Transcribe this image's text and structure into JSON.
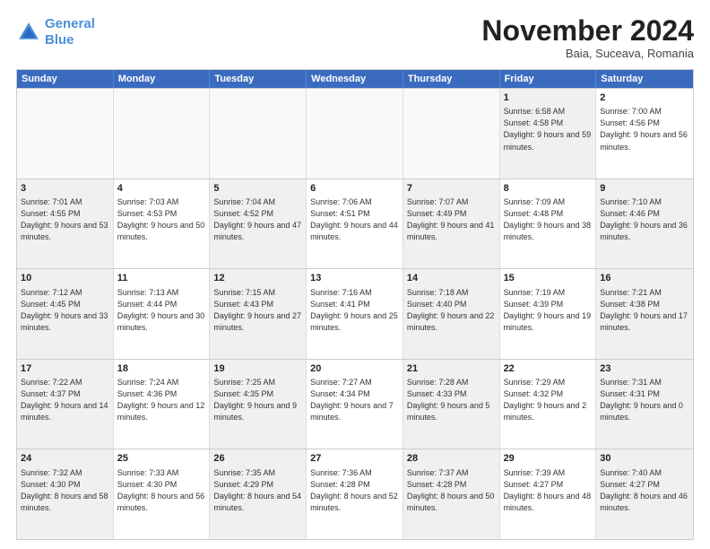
{
  "logo": {
    "line1": "General",
    "line2": "Blue"
  },
  "title": "November 2024",
  "location": "Baia, Suceava, Romania",
  "headers": [
    "Sunday",
    "Monday",
    "Tuesday",
    "Wednesday",
    "Thursday",
    "Friday",
    "Saturday"
  ],
  "weeks": [
    [
      {
        "day": "",
        "info": "",
        "empty": true
      },
      {
        "day": "",
        "info": "",
        "empty": true
      },
      {
        "day": "",
        "info": "",
        "empty": true
      },
      {
        "day": "",
        "info": "",
        "empty": true
      },
      {
        "day": "",
        "info": "",
        "empty": true
      },
      {
        "day": "1",
        "info": "Sunrise: 6:58 AM\nSunset: 4:58 PM\nDaylight: 9 hours and 59 minutes.",
        "shaded": true
      },
      {
        "day": "2",
        "info": "Sunrise: 7:00 AM\nSunset: 4:56 PM\nDaylight: 9 hours and 56 minutes.",
        "shaded": false
      }
    ],
    [
      {
        "day": "3",
        "info": "Sunrise: 7:01 AM\nSunset: 4:55 PM\nDaylight: 9 hours and 53 minutes.",
        "shaded": true
      },
      {
        "day": "4",
        "info": "Sunrise: 7:03 AM\nSunset: 4:53 PM\nDaylight: 9 hours and 50 minutes.",
        "shaded": false
      },
      {
        "day": "5",
        "info": "Sunrise: 7:04 AM\nSunset: 4:52 PM\nDaylight: 9 hours and 47 minutes.",
        "shaded": true
      },
      {
        "day": "6",
        "info": "Sunrise: 7:06 AM\nSunset: 4:51 PM\nDaylight: 9 hours and 44 minutes.",
        "shaded": false
      },
      {
        "day": "7",
        "info": "Sunrise: 7:07 AM\nSunset: 4:49 PM\nDaylight: 9 hours and 41 minutes.",
        "shaded": true
      },
      {
        "day": "8",
        "info": "Sunrise: 7:09 AM\nSunset: 4:48 PM\nDaylight: 9 hours and 38 minutes.",
        "shaded": false
      },
      {
        "day": "9",
        "info": "Sunrise: 7:10 AM\nSunset: 4:46 PM\nDaylight: 9 hours and 36 minutes.",
        "shaded": true
      }
    ],
    [
      {
        "day": "10",
        "info": "Sunrise: 7:12 AM\nSunset: 4:45 PM\nDaylight: 9 hours and 33 minutes.",
        "shaded": true
      },
      {
        "day": "11",
        "info": "Sunrise: 7:13 AM\nSunset: 4:44 PM\nDaylight: 9 hours and 30 minutes.",
        "shaded": false
      },
      {
        "day": "12",
        "info": "Sunrise: 7:15 AM\nSunset: 4:43 PM\nDaylight: 9 hours and 27 minutes.",
        "shaded": true
      },
      {
        "day": "13",
        "info": "Sunrise: 7:16 AM\nSunset: 4:41 PM\nDaylight: 9 hours and 25 minutes.",
        "shaded": false
      },
      {
        "day": "14",
        "info": "Sunrise: 7:18 AM\nSunset: 4:40 PM\nDaylight: 9 hours and 22 minutes.",
        "shaded": true
      },
      {
        "day": "15",
        "info": "Sunrise: 7:19 AM\nSunset: 4:39 PM\nDaylight: 9 hours and 19 minutes.",
        "shaded": false
      },
      {
        "day": "16",
        "info": "Sunrise: 7:21 AM\nSunset: 4:38 PM\nDaylight: 9 hours and 17 minutes.",
        "shaded": true
      }
    ],
    [
      {
        "day": "17",
        "info": "Sunrise: 7:22 AM\nSunset: 4:37 PM\nDaylight: 9 hours and 14 minutes.",
        "shaded": true
      },
      {
        "day": "18",
        "info": "Sunrise: 7:24 AM\nSunset: 4:36 PM\nDaylight: 9 hours and 12 minutes.",
        "shaded": false
      },
      {
        "day": "19",
        "info": "Sunrise: 7:25 AM\nSunset: 4:35 PM\nDaylight: 9 hours and 9 minutes.",
        "shaded": true
      },
      {
        "day": "20",
        "info": "Sunrise: 7:27 AM\nSunset: 4:34 PM\nDaylight: 9 hours and 7 minutes.",
        "shaded": false
      },
      {
        "day": "21",
        "info": "Sunrise: 7:28 AM\nSunset: 4:33 PM\nDaylight: 9 hours and 5 minutes.",
        "shaded": true
      },
      {
        "day": "22",
        "info": "Sunrise: 7:29 AM\nSunset: 4:32 PM\nDaylight: 9 hours and 2 minutes.",
        "shaded": false
      },
      {
        "day": "23",
        "info": "Sunrise: 7:31 AM\nSunset: 4:31 PM\nDaylight: 9 hours and 0 minutes.",
        "shaded": true
      }
    ],
    [
      {
        "day": "24",
        "info": "Sunrise: 7:32 AM\nSunset: 4:30 PM\nDaylight: 8 hours and 58 minutes.",
        "shaded": true
      },
      {
        "day": "25",
        "info": "Sunrise: 7:33 AM\nSunset: 4:30 PM\nDaylight: 8 hours and 56 minutes.",
        "shaded": false
      },
      {
        "day": "26",
        "info": "Sunrise: 7:35 AM\nSunset: 4:29 PM\nDaylight: 8 hours and 54 minutes.",
        "shaded": true
      },
      {
        "day": "27",
        "info": "Sunrise: 7:36 AM\nSunset: 4:28 PM\nDaylight: 8 hours and 52 minutes.",
        "shaded": false
      },
      {
        "day": "28",
        "info": "Sunrise: 7:37 AM\nSunset: 4:28 PM\nDaylight: 8 hours and 50 minutes.",
        "shaded": true
      },
      {
        "day": "29",
        "info": "Sunrise: 7:39 AM\nSunset: 4:27 PM\nDaylight: 8 hours and 48 minutes.",
        "shaded": false
      },
      {
        "day": "30",
        "info": "Sunrise: 7:40 AM\nSunset: 4:27 PM\nDaylight: 8 hours and 46 minutes.",
        "shaded": true
      }
    ]
  ]
}
